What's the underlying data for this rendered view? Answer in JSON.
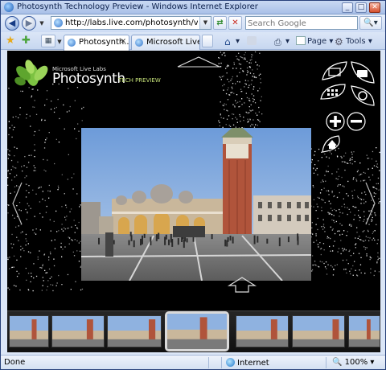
{
  "window": {
    "title": "Photosynth Technology Preview - Windows Internet Explorer",
    "minimize_label": "_",
    "maximize_label": "□",
    "close_label": "✕"
  },
  "address_bar": {
    "url": "http://labs.live.com/photosynth/view.htm",
    "search_placeholder": "Search Google",
    "search_go": "🔍▾"
  },
  "tabs": [
    {
      "label": "Photosynth...",
      "active": true
    },
    {
      "label": "Microsoft Live...",
      "active": false
    }
  ],
  "toolbar": {
    "page_label": "Page",
    "tools_label": "Tools"
  },
  "viewer": {
    "logo_small": "Microsoft Live Labs",
    "logo_big": "Photosynth",
    "logo_tag": "TECH PREVIEW",
    "controls": [
      "email-icon",
      "camera-icon",
      "grid-icon",
      "rotate-icon",
      "zoom-in-icon",
      "zoom-out-icon",
      "home-icon"
    ]
  },
  "thumbnails": [
    {
      "name": "thumbnail-1",
      "selected": false
    },
    {
      "name": "thumbnail-2",
      "selected": false
    },
    {
      "name": "thumbnail-3",
      "selected": false
    },
    {
      "name": "thumbnail-4",
      "selected": true
    },
    {
      "name": "thumbnail-5",
      "selected": false
    },
    {
      "name": "thumbnail-6",
      "selected": false
    },
    {
      "name": "thumbnail-7",
      "selected": false
    }
  ],
  "status_bar": {
    "text": "Done",
    "zone": "Internet",
    "zoom": "100%"
  },
  "colors": {
    "accent": "#1b5db8",
    "viewer_bg": "#000000",
    "logo_green": "#7cc242"
  }
}
